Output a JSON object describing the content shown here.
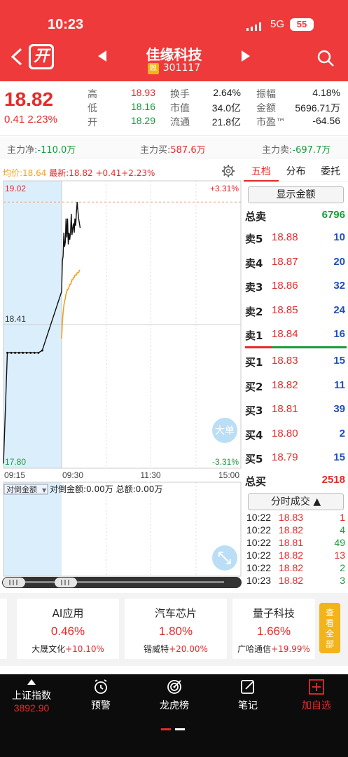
{
  "status": {
    "time": "10:23",
    "network": "5G",
    "battery": "55"
  },
  "header": {
    "logo_text": "开",
    "stock_name": "佳缘科技",
    "badge": "融",
    "code": "301117"
  },
  "quote": {
    "price": "18.82",
    "change": "0.41",
    "change_pct": "2.23%",
    "cells": [
      {
        "label": "高",
        "value": "18.93",
        "color": "red"
      },
      {
        "label": "低",
        "value": "18.16",
        "color": "green"
      },
      {
        "label": "开",
        "value": "18.29",
        "color": "green"
      },
      {
        "label": "换手",
        "value": "2.64%",
        "color": ""
      },
      {
        "label": "市值",
        "value": "34.0亿",
        "color": ""
      },
      {
        "label": "流通",
        "value": "21.8亿",
        "color": ""
      },
      {
        "label": "振幅",
        "value": "4.18%",
        "color": ""
      },
      {
        "label": "金额",
        "value": "5696.71万",
        "color": ""
      },
      {
        "label": "市盈™",
        "value": "-64.56",
        "color": ""
      }
    ]
  },
  "flow": {
    "net_label": "主力净:",
    "net_value": "-110.0万",
    "buy_label": "主力买:",
    "buy_value": "587.6万",
    "sell_label": "主力卖:",
    "sell_value": "-697.7万"
  },
  "chart": {
    "avg_label": "均价:",
    "avg_value": "18.64",
    "latest_label": "最新:",
    "latest_value": "18.82",
    "latest_change": "+0.41",
    "latest_pct": "+2.23%",
    "y_top": "19.02",
    "y_mid": "18.41",
    "y_bottom": "17.80",
    "pct_top": "+3.31%",
    "pct_bottom": "-3.31%",
    "x_labels": [
      "09:15",
      "09:30",
      "11:30",
      "15:00"
    ],
    "big_order_btn": "大单",
    "indicator_select": "对倒金额",
    "indicator_text": "对倒金额:0.00万 总额:0.00万"
  },
  "chart_data": {
    "type": "line",
    "title": "",
    "xlabel": "",
    "ylabel": "",
    "ylim": [
      17.8,
      19.02
    ],
    "x_ticks": [
      "09:15",
      "09:30",
      "11:30",
      "15:00"
    ],
    "series": [
      {
        "name": "最新",
        "x": [
          "09:15",
          "09:16",
          "09:17",
          "09:18",
          "09:19",
          "09:20",
          "09:21",
          "09:22",
          "09:23",
          "09:24",
          "09:25",
          "09:30",
          "09:31",
          "09:32",
          "09:33",
          "09:34",
          "09:35",
          "09:36",
          "09:37",
          "09:38",
          "09:39",
          "09:40",
          "09:41",
          "09:42",
          "09:43",
          "09:44",
          "09:45",
          "09:46",
          "09:47",
          "09:48",
          "09:49",
          "09:50",
          "09:51",
          "09:52",
          "09:53",
          "09:54",
          "09:55"
        ],
        "values": [
          17.82,
          18.29,
          18.29,
          18.29,
          18.29,
          18.29,
          18.29,
          18.29,
          18.29,
          18.29,
          18.3,
          18.55,
          18.68,
          18.7,
          18.8,
          18.74,
          18.76,
          18.86,
          18.78,
          18.86,
          18.75,
          18.8,
          18.77,
          18.8,
          18.88,
          18.79,
          18.82,
          18.84,
          18.8,
          18.86,
          18.83,
          18.89,
          18.93,
          18.89,
          18.86,
          18.84,
          18.82
        ]
      },
      {
        "name": "均价",
        "x": [
          "09:30",
          "09:31",
          "09:32",
          "09:33",
          "09:34",
          "09:35",
          "09:36",
          "09:37",
          "09:38",
          "09:39",
          "09:40",
          "09:41",
          "09:42",
          "09:43",
          "09:44",
          "09:45",
          "09:46",
          "09:47",
          "09:48",
          "09:49",
          "09:50",
          "09:51",
          "09:52",
          "09:53",
          "09:54",
          "09:55"
        ],
        "values": [
          18.35,
          18.42,
          18.46,
          18.49,
          18.51,
          18.52,
          18.54,
          18.55,
          18.56,
          18.56,
          18.57,
          18.58,
          18.58,
          18.59,
          18.6,
          18.6,
          18.61,
          18.61,
          18.62,
          18.62,
          18.62,
          18.63,
          18.63,
          18.63,
          18.64,
          18.64
        ]
      }
    ]
  },
  "order_book": {
    "tabs": [
      "五档",
      "分布",
      "委托"
    ],
    "show_amount": "显示金额",
    "total_sell_label": "总卖",
    "total_sell": "6796",
    "asks": [
      {
        "label": "卖5",
        "price": "18.88",
        "vol": "10"
      },
      {
        "label": "卖4",
        "price": "18.87",
        "vol": "20"
      },
      {
        "label": "卖3",
        "price": "18.86",
        "vol": "32"
      },
      {
        "label": "卖2",
        "price": "18.85",
        "vol": "24"
      },
      {
        "label": "卖1",
        "price": "18.84",
        "vol": "16"
      }
    ],
    "bids": [
      {
        "label": "买1",
        "price": "18.83",
        "vol": "15"
      },
      {
        "label": "买2",
        "price": "18.82",
        "vol": "11"
      },
      {
        "label": "买3",
        "price": "18.81",
        "vol": "39"
      },
      {
        "label": "买4",
        "price": "18.80",
        "vol": "2"
      },
      {
        "label": "买5",
        "price": "18.79",
        "vol": "15"
      }
    ],
    "total_buy_label": "总买",
    "total_buy": "2518",
    "ticks_btn": "分时成交",
    "ticks": [
      {
        "time": "10:22",
        "price": "18.83",
        "vol": "1",
        "side": "red"
      },
      {
        "time": "10:22",
        "price": "18.82",
        "vol": "4",
        "side": "green"
      },
      {
        "time": "10:22",
        "price": "18.81",
        "vol": "49",
        "side": "green"
      },
      {
        "time": "10:22",
        "price": "18.82",
        "vol": "13",
        "side": "red"
      },
      {
        "time": "10:22",
        "price": "18.82",
        "vol": "2",
        "side": "green"
      },
      {
        "time": "10:23",
        "price": "18.82",
        "vol": "3",
        "side": "green"
      }
    ]
  },
  "sectors": [
    {
      "name": "AI应用",
      "pct": "0.46%",
      "leader": "大晟文化",
      "leader_pct": "+10.10%"
    },
    {
      "name": "汽车芯片",
      "pct": "1.80%",
      "leader": "锴威特",
      "leader_pct": "+20.00%"
    },
    {
      "name": "量子科技",
      "pct": "1.66%",
      "leader": "广哈通信",
      "leader_pct": "+19.99%"
    }
  ],
  "view_all": "查看全部",
  "tabbar": {
    "index_name": "上证指数",
    "index_value": "3892.90",
    "items": [
      "预警",
      "龙虎榜",
      "笔记",
      "加自选"
    ]
  },
  "colors": {
    "brand_red": "#ee3a3a",
    "up_red": "#e52b2b",
    "down_green": "#1a9a3a",
    "avg_orange": "#f0a020",
    "auction_blue": "#dbeefb"
  }
}
